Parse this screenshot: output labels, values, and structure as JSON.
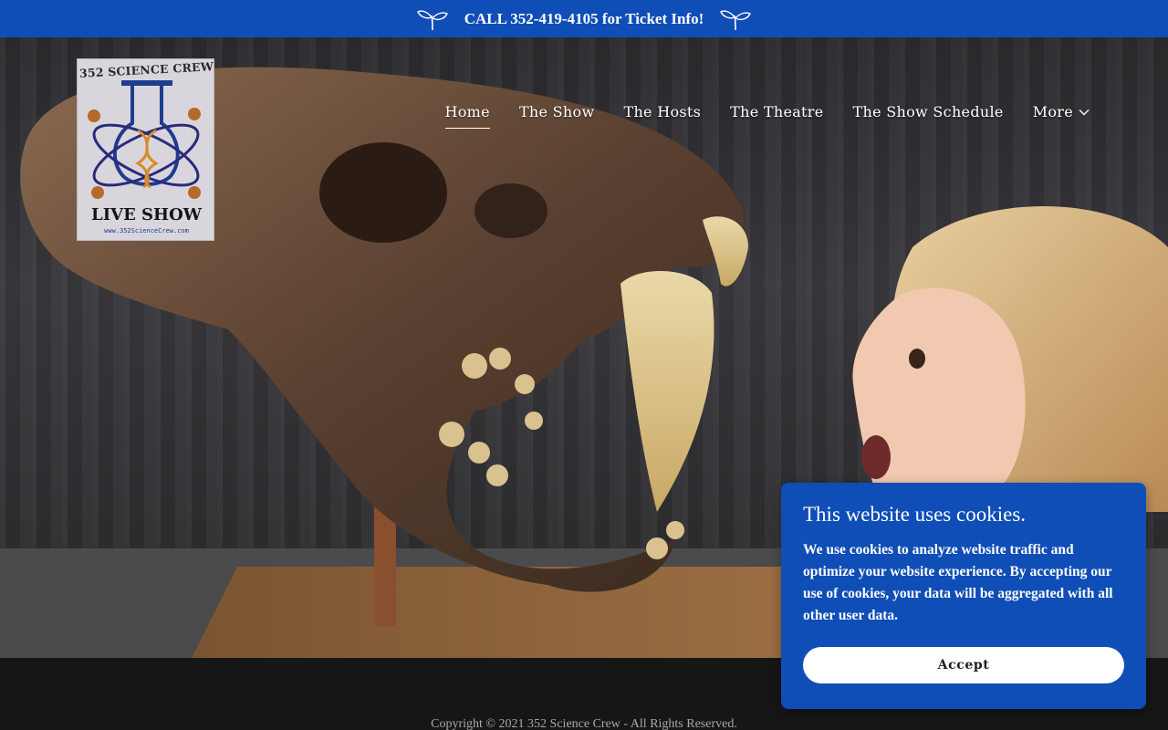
{
  "topbar": {
    "message": "CALL 352-419-4105 for Ticket Info!",
    "left_icon": "sprout-icon",
    "right_icon": "sprout-icon",
    "color": "#0f4eb6"
  },
  "logo": {
    "top_text": "352 SCIENCE CREW",
    "main_text": "LIVE SHOW",
    "url_text": "www.352ScienceCrew.com"
  },
  "nav": {
    "items": [
      {
        "label": "Home",
        "active": true
      },
      {
        "label": "The Show"
      },
      {
        "label": "The Hosts"
      },
      {
        "label": "The Theatre"
      },
      {
        "label": "The Show Schedule"
      }
    ],
    "more_label": "More"
  },
  "hero": {
    "description_icon": "hero-image"
  },
  "cookie": {
    "title": "This website uses cookies.",
    "body": "We use cookies to analyze website traffic and optimize your website experience. By accepting our use of cookies, your data will be aggregated with all other user data.",
    "accept_label": "Accept",
    "color": "#0f4eb6"
  },
  "footer": {
    "copyright": "Copyright © 2021 352 Science Crew - All Rights Reserved."
  }
}
